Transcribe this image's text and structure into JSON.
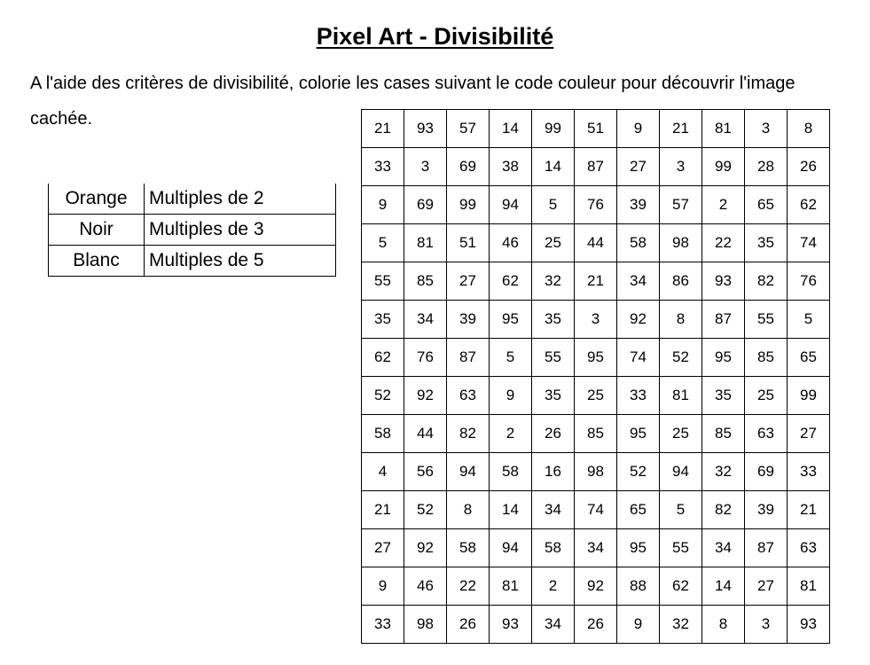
{
  "title": "Pixel Art - Divisibilité",
  "instructions": "A l'aide des critères de divisibilité, colorie les cases suivant le code couleur pour découvrir l'image cachée.",
  "legend": [
    {
      "color": "Orange",
      "rule": "Multiples de 2"
    },
    {
      "color": "Noir",
      "rule": "Multiples de 3"
    },
    {
      "color": "Blanc",
      "rule": "Multiples de 5"
    }
  ],
  "grid": [
    [
      "21",
      "93",
      "57",
      "14",
      "99",
      "51",
      "9",
      "21",
      "81",
      "3",
      "8"
    ],
    [
      "33",
      "3",
      "69",
      "38",
      "14",
      "87",
      "27",
      "3",
      "99",
      "28",
      "26"
    ],
    [
      "9",
      "69",
      "99",
      "94",
      "5",
      "76",
      "39",
      "57",
      "2",
      "65",
      "62"
    ],
    [
      "5",
      "81",
      "51",
      "46",
      "25",
      "44",
      "58",
      "98",
      "22",
      "35",
      "74"
    ],
    [
      "55",
      "85",
      "27",
      "62",
      "32",
      "21",
      "34",
      "86",
      "93",
      "82",
      "76"
    ],
    [
      "35",
      "34",
      "39",
      "95",
      "35",
      "3",
      "92",
      "8",
      "87",
      "55",
      "5"
    ],
    [
      "62",
      "76",
      "87",
      "5",
      "55",
      "95",
      "74",
      "52",
      "95",
      "85",
      "65"
    ],
    [
      "52",
      "92",
      "63",
      "9",
      "35",
      "25",
      "33",
      "81",
      "35",
      "25",
      "99"
    ],
    [
      "58",
      "44",
      "82",
      "2",
      "26",
      "85",
      "95",
      "25",
      "85",
      "63",
      "27"
    ],
    [
      "4",
      "56",
      "94",
      "58",
      "16",
      "98",
      "52",
      "94",
      "32",
      "69",
      "33"
    ],
    [
      "21",
      "52",
      "8",
      "14",
      "34",
      "74",
      "65",
      "5",
      "82",
      "39",
      "21"
    ],
    [
      "27",
      "92",
      "58",
      "94",
      "58",
      "34",
      "95",
      "55",
      "34",
      "87",
      "63"
    ],
    [
      "9",
      "46",
      "22",
      "81",
      "2",
      "92",
      "88",
      "62",
      "14",
      "27",
      "81"
    ],
    [
      "33",
      "98",
      "26",
      "93",
      "34",
      "26",
      "9",
      "32",
      "8",
      "3",
      "93"
    ]
  ]
}
